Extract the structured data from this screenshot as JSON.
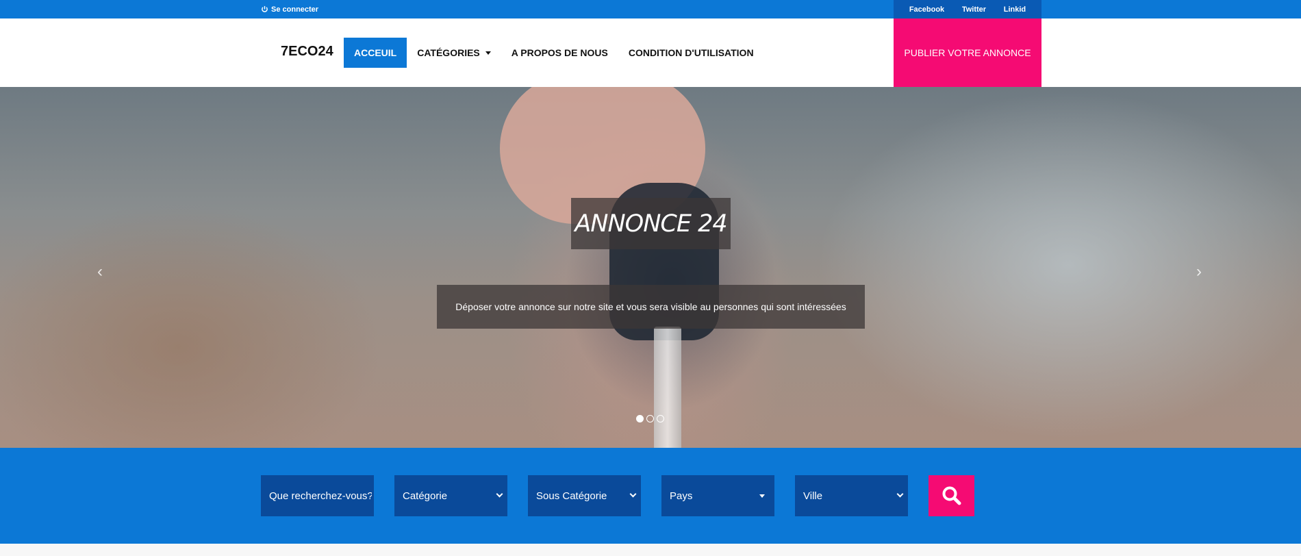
{
  "topbar": {
    "login_label": "Se connecter",
    "social": [
      "Facebook",
      "Twitter",
      "Linkid"
    ],
    "color": "#0c78d6"
  },
  "header": {
    "logo": "7ECO24",
    "nav": [
      {
        "label": "ACCEUIL",
        "active": true
      },
      {
        "label": "CATÉGORIES",
        "dropdown": true
      },
      {
        "label": "A PROPOS DE NOUS"
      },
      {
        "label": "CONDITION D'UTILISATION"
      }
    ],
    "publish_label": "PUBLIER VOTRE ANNONCE",
    "publish_color": "#f50b73"
  },
  "hero": {
    "title": "ANNONCE 24",
    "subtitle": "Déposer votre annonce sur notre site et vous sera visible au personnes qui sont intéressées",
    "prev_icon": "‹",
    "next_icon": "›",
    "slides_count": 3,
    "active_slide": 1
  },
  "search": {
    "query_placeholder": "Que recherchez-vous?",
    "category": "Catégorie",
    "subcategory": "Sous Catégorie",
    "country": "Pays",
    "city": "Ville",
    "button_icon": "search-icon"
  }
}
